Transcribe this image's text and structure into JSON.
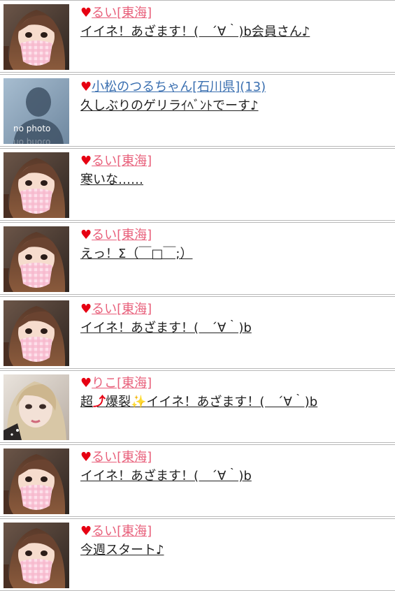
{
  "colors": {
    "heart": "#e60012",
    "name_pink": "#e8607b",
    "name_blue": "#3a6fb0",
    "divider": "#b8b8b8"
  },
  "heart_glyph": "♥",
  "no_photo_text": "no photo",
  "posts": [
    {
      "avatar": "rui",
      "name": "るい[東海]",
      "message": "イイネ！あざます！(　´∀｀)b会員さん♪"
    },
    {
      "avatar": "no-photo",
      "name": "小松のつるちゃん[石川県](13)",
      "message": "久しぶりのゲリラｲﾍﾞﾝﾄでーす♪"
    },
    {
      "avatar": "rui",
      "name": "るい[東海]",
      "message": "寒いな……"
    },
    {
      "avatar": "rui",
      "name": "るい[東海]",
      "message": "えっ！Σ（￣□￣;）"
    },
    {
      "avatar": "rui",
      "name": "るい[東海]",
      "message": "イイネ！あざます！(　´∀｀)b"
    },
    {
      "avatar": "riko",
      "name": "りこ[東海]",
      "message_parts": [
        "超",
        "⤴",
        "爆裂",
        "✨",
        "イイネ！あざます！(　´∀｀)b"
      ]
    },
    {
      "avatar": "rui",
      "name": "るい[東海]",
      "message": "イイネ！あざます！(　´∀｀)b"
    },
    {
      "avatar": "rui",
      "name": "るい[東海]",
      "message": "今週スタート♪"
    }
  ]
}
